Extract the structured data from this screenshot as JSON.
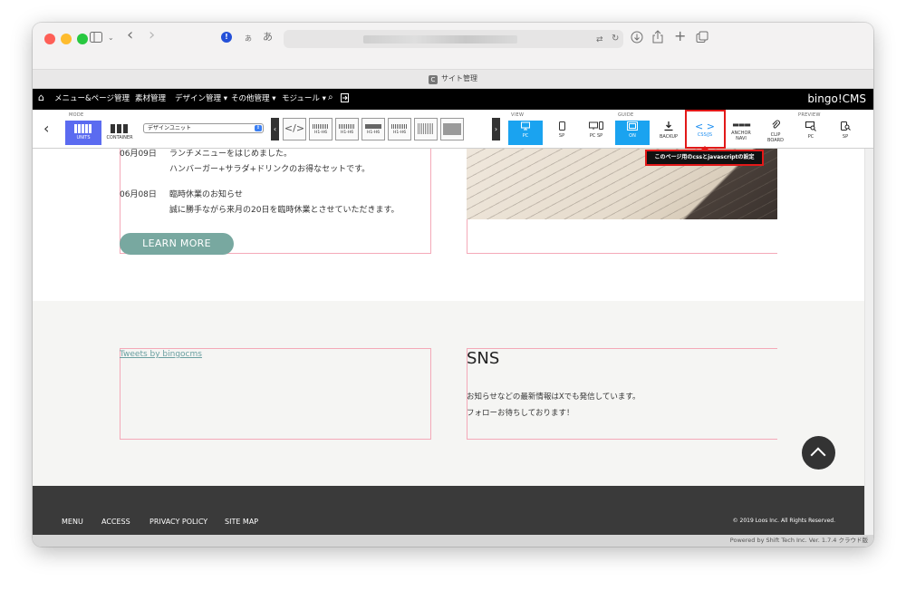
{
  "browser": {
    "tab_title": "サイト管理",
    "tab_favicon": "C",
    "ext_badge": "!",
    "input_a_small": "あ",
    "input_a_large": "あ"
  },
  "cms_nav": {
    "items": [
      "メニュー&ページ管理",
      "素材管理",
      "デザイン管理 ▾",
      "その他管理 ▾",
      "モジュール ▾"
    ],
    "brand": "bingo!CMS"
  },
  "toolbar": {
    "mode_label": "MODE",
    "units_label": "UNITS",
    "container_label": "CONTAINER",
    "design_select_value": "デザインユニット",
    "unit_buttons": [
      "",
      "H1-H6",
      "H1-H6",
      "H1-H6",
      "H1-H6",
      "",
      ""
    ],
    "view_label": "VIEW",
    "view_pc": "PC",
    "view_sp": "SP",
    "view_pcsp": "PC SP",
    "guide_label": "GUIDE",
    "guide_on": "ON",
    "backup": "BACKUP",
    "cssjs": "CSS/JS",
    "anchor_line1": "ANCHOR",
    "anchor_line2": "NAVI",
    "clip_line1": "CLIP",
    "clip_line2": "BOARD",
    "preview_label": "PREVIEW",
    "preview_pc": "PC",
    "preview_sp": "SP"
  },
  "tooltip": "このページ用のcssとjavascriptの設定",
  "news": [
    {
      "date": "06月09日",
      "title": "ランチメニューをはじめました。",
      "body": "ハンバーガー+サラダ+ドリンクのお得なセットです。"
    },
    {
      "date": "06月08日",
      "title": "臨時休業のお知らせ",
      "body": "誠に勝手ながら来月の20日を臨時休業とさせていただきます。"
    }
  ],
  "learn_more": "LEARN MORE",
  "tweets_link": "Tweets by bingocms",
  "sns": {
    "title": "SNS",
    "line1": "お知らせなどの最新情報はXでも発信しています。",
    "line2": "フォローお待ちしております！"
  },
  "footer": {
    "links": [
      "MENU",
      "ACCESS",
      "PRIVACY POLICY",
      "SITE MAP"
    ],
    "copyright": "© 2019 Loos Inc. All Rights Reserved."
  },
  "powered_by": "Powered by Shift Tech Inc. Ver. 1.7.4 クラウド版",
  "colors": {
    "accent_blue": "#1aa3f0",
    "highlight_red": "#e21919",
    "learn_more_bg": "#78a8a0",
    "footer_bg": "#3a3a3a"
  }
}
